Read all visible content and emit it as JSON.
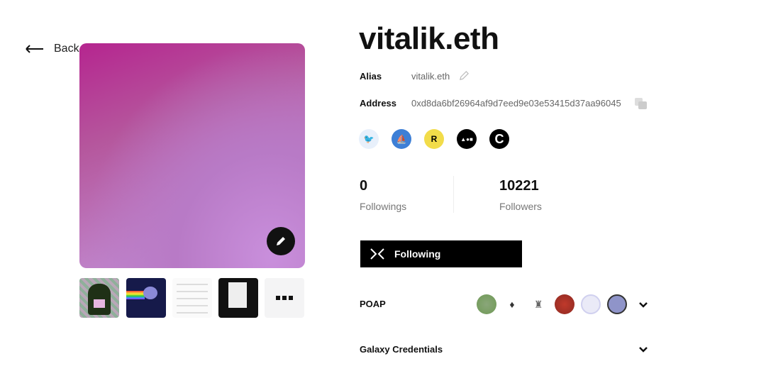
{
  "nav": {
    "back_label": "Back"
  },
  "profile": {
    "name": "vitalik.eth",
    "alias_label": "Alias",
    "alias_value": "vitalik.eth",
    "address_label": "Address",
    "address_value": "0xd8da6bf26964af9d7eed9e03e53415d37aa96045",
    "socials": [
      {
        "icon": "twitter-icon",
        "color": "#e8f0fb"
      },
      {
        "icon": "opensea-icon",
        "color": "#3d7fd6"
      },
      {
        "icon": "rarible-icon",
        "color": "#f2dc4a",
        "text": "R"
      },
      {
        "icon": "foundation-icon",
        "color": "#000000"
      },
      {
        "icon": "cyberconnect-icon",
        "color": "#000000",
        "text": "C"
      }
    ]
  },
  "stats": {
    "followings_count": "0",
    "followings_label": "Followings",
    "followers_count": "10221",
    "followers_label": "Followers"
  },
  "follow_button": {
    "label": "Following"
  },
  "sections": {
    "poap_label": "POAP",
    "galaxy_label": "Galaxy Credentials"
  },
  "colors": {
    "accent": "#000000",
    "hero_gradient_start": "#b5258f",
    "hero_gradient_end": "#c690d6"
  }
}
